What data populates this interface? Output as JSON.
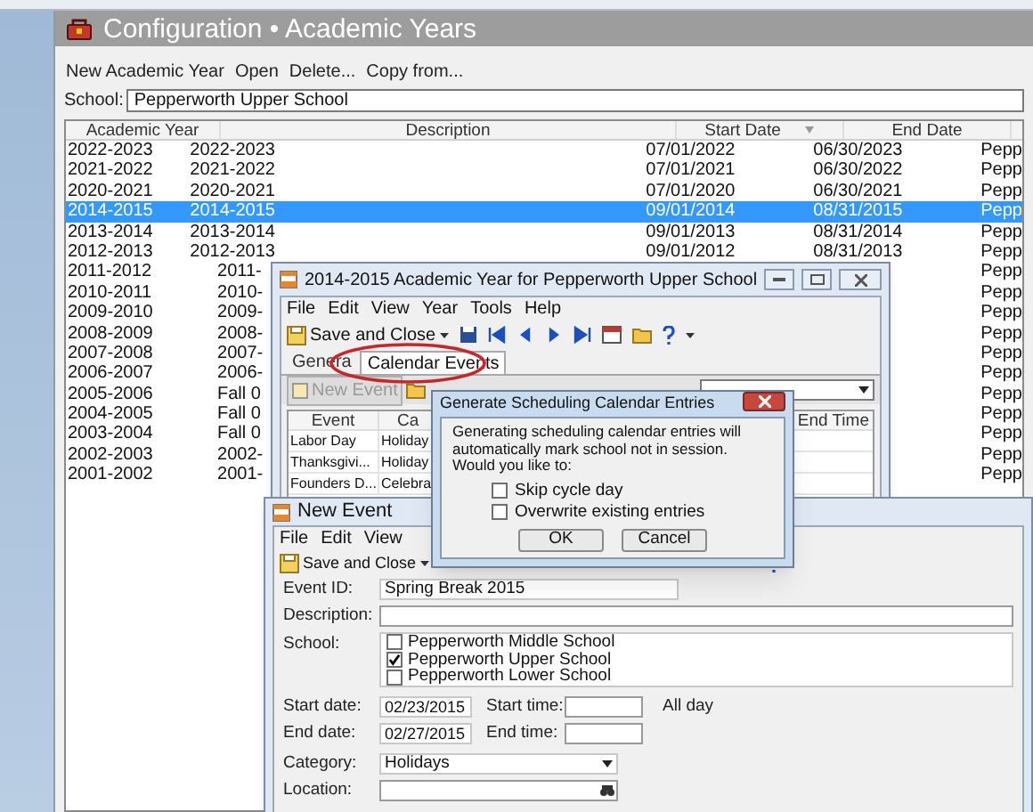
{
  "main_window": {
    "title": "Configuration • Academic Years",
    "toolbar": [
      "New Academic Year",
      "Open",
      "Delete...",
      "Copy from..."
    ],
    "school": {
      "label": "School:",
      "value": "Pepperworth Upper School"
    },
    "table": {
      "columns": [
        "Academic Year",
        "Description",
        "Start Date",
        "End Date"
      ],
      "rows": [
        {
          "year": "2022-2023",
          "description": "2022-2023",
          "start_date": "07/01/2022",
          "end_date": "06/30/2023",
          "column_5": "Pepp",
          "selected": false
        },
        {
          "year": "2021-2022",
          "description": "2021-2022",
          "start_date": "07/01/2021",
          "end_date": "06/30/2022",
          "column_5": "Pepp",
          "selected": false
        },
        {
          "year": "2020-2021",
          "description": "2020-2021",
          "start_date": "07/01/2020",
          "end_date": "06/30/2021",
          "column_5": "Pepp",
          "selected": false
        },
        {
          "year": "2014-2015",
          "description": "2014-2015",
          "start_date": "09/01/2014",
          "end_date": "08/31/2015",
          "column_5": "Pepp",
          "selected": true
        },
        {
          "year": "2013-2014",
          "description": "2013-2014",
          "start_date": "09/01/2013",
          "end_date": "08/31/2014",
          "column_5": "Pepp",
          "selected": false
        },
        {
          "year": "2012-2013",
          "description": "2012-2013",
          "start_date": "09/01/2012",
          "end_date": "08/31/2013",
          "column_5": "Pepp",
          "selected": false
        },
        {
          "year": "2011-2012",
          "description": "2011-",
          "column_5": "Pepp",
          "selected": false
        },
        {
          "year": "2010-2011",
          "description": "2010-",
          "column_5": "Pepp",
          "selected": false
        },
        {
          "year": "2009-2010",
          "description": "2009-",
          "column_5": "Pepp",
          "selected": false
        },
        {
          "year": "2008-2009",
          "description": "2008-",
          "column_5": "Pepp",
          "selected": false
        },
        {
          "year": "2007-2008",
          "description": "2007-",
          "column_5": "Pepp",
          "selected": false
        },
        {
          "year": "2006-2007",
          "description": "2006-",
          "column_5": "Pepp",
          "selected": false
        },
        {
          "year": "2005-2006",
          "description": "Fall 0",
          "column_5": "Pepp",
          "selected": false
        },
        {
          "year": "2004-2005",
          "description": "Fall 0",
          "column_5": "Pepp",
          "selected": false
        },
        {
          "year": "2003-2004",
          "description": "Fall 0",
          "column_5": "Pepp",
          "selected": false
        },
        {
          "year": "2002-2003",
          "description": "2002-",
          "column_5": "Pepp",
          "selected": false
        },
        {
          "year": "2001-2002",
          "description": "2001-",
          "column_5": "Pepp",
          "selected": false
        }
      ]
    }
  },
  "year_window": {
    "title": "2014-2015 Academic Year for Pepperworth Upper School",
    "menu": [
      "File",
      "Edit",
      "View",
      "Year",
      "Tools",
      "Help"
    ],
    "save_button": "Save and Close",
    "tabs": [
      {
        "label": "Genera",
        "selected": false
      },
      {
        "label": "Calendar Events",
        "selected": true
      }
    ],
    "new_event_button": "New Event",
    "events": {
      "columns": [
        "Event",
        "Ca",
        "End Time"
      ],
      "rows": [
        {
          "event": "Labor Day",
          "category": "Holiday"
        },
        {
          "event": "Thanksgivi...",
          "category": "Holiday"
        },
        {
          "event": "Founders D...",
          "category": "Celebra"
        }
      ]
    }
  },
  "new_event_window": {
    "title": "New Event",
    "menu": [
      "File",
      "Edit",
      "View"
    ],
    "save_button": "Save and Close",
    "event_id": {
      "label": "Event ID:",
      "value": "Spring Break 2015"
    },
    "description": {
      "label": "Description:"
    },
    "school": {
      "label": "School:",
      "options": [
        {
          "label": "Pepperworth Middle School",
          "checked": false
        },
        {
          "label": "Pepperworth Upper School",
          "checked": true
        },
        {
          "label": "Pepperworth Lower School",
          "checked": false
        }
      ]
    },
    "start_date": {
      "label": "Start date:",
      "value": "02/23/2015"
    },
    "start_time": {
      "label": "Start time:"
    },
    "all_day": "All day",
    "end_date": {
      "label": "End date:",
      "value": "02/27/2015"
    },
    "end_time": {
      "label": "End time:"
    },
    "category": {
      "label": "Category:",
      "value": "Holidays"
    },
    "location": {
      "label": "Location:"
    }
  },
  "dialog": {
    "title": "Generate Scheduling Calendar Entries",
    "message": "Generating scheduling calendar entries will automatically mark school not in session.  Would you like to:",
    "options": [
      {
        "label": "Skip cycle day",
        "checked": false
      },
      {
        "label": "Overwrite existing entries",
        "checked": false
      }
    ],
    "buttons": [
      "OK",
      "Cancel"
    ]
  }
}
